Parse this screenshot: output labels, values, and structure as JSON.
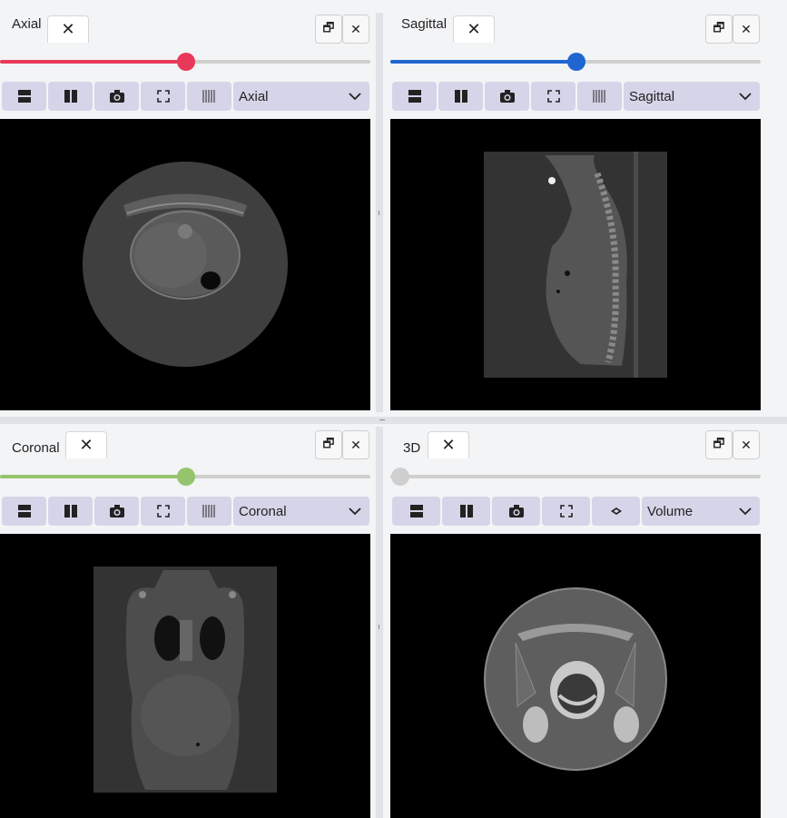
{
  "panels": {
    "axial": {
      "tab": "Axial",
      "slider_value": 0.5,
      "color": "#e8395a",
      "select": "Axial"
    },
    "sagittal": {
      "tab": "Sagittal",
      "slider_value": 0.5,
      "color": "#1f66d1",
      "select": "Sagittal"
    },
    "coronal": {
      "tab": "Coronal",
      "slider_value": 0.5,
      "color": "#96c46e",
      "select": "Coronal"
    },
    "three_d": {
      "tab": "3D",
      "slider_value": 0.0,
      "color": "#c8c8c8",
      "select": "Volume"
    }
  },
  "icons": {
    "close": "✕",
    "restore": "🗗",
    "layout_rows": "rows-layout-icon",
    "layout_cols": "columns-layout-icon",
    "camera": "camera-icon",
    "fullscreen": "fullscreen-icon",
    "slices": "slices-icon",
    "view3d": "view3d-icon",
    "chevron": "chevron-down-icon"
  }
}
